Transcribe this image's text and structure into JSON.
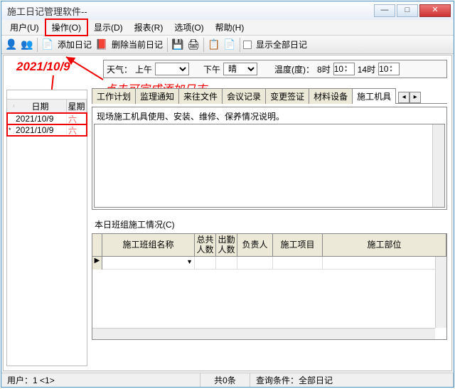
{
  "window": {
    "title": "施工日记管理软件--"
  },
  "menu": {
    "items": [
      "用户(U)",
      "操作(O)",
      "显示(D)",
      "报表(R)",
      "选项(O)",
      "帮助(H)"
    ],
    "highlighted_index": 1
  },
  "toolbar": {
    "add_label": "添加日记",
    "del_label": "删除当前日记",
    "show_all_label": "显示全部日记"
  },
  "weather": {
    "label": "天气：",
    "am_label": "上午",
    "am_value": "",
    "pm_label": "下午",
    "pm_value": "晴",
    "temp_label": "温度(度)：",
    "time1_label": "8时",
    "time1_value": "10",
    "time2_label": "14时",
    "time2_value": "10"
  },
  "annotation": {
    "date": "2021/10/9",
    "text": "点击可完成添加日志"
  },
  "date_list": {
    "col_date": "日期",
    "col_week": "星期",
    "rows": [
      {
        "date": "2021/10/9",
        "week": "六"
      },
      {
        "date": "2021/10/9",
        "week": "六"
      }
    ]
  },
  "tabs": {
    "items": [
      "工作计划",
      "监理通知",
      "来往文件",
      "会议记录",
      "变更签证",
      "材料设备",
      "施工机具"
    ],
    "active_index": 6
  },
  "section1": {
    "label": "现场施工机具使用、安装、维修、保养情况说明。"
  },
  "section2": {
    "group_label": "本日班组施工情况(C)",
    "columns": [
      "施工班组名称",
      "总共人数",
      "出勤人数",
      "负责人",
      "施工项目",
      "施工部位"
    ]
  },
  "status": {
    "user": "用户：1 <1>",
    "count": "共0条",
    "filter_label": "查询条件：",
    "filter_value": "全部日记"
  }
}
